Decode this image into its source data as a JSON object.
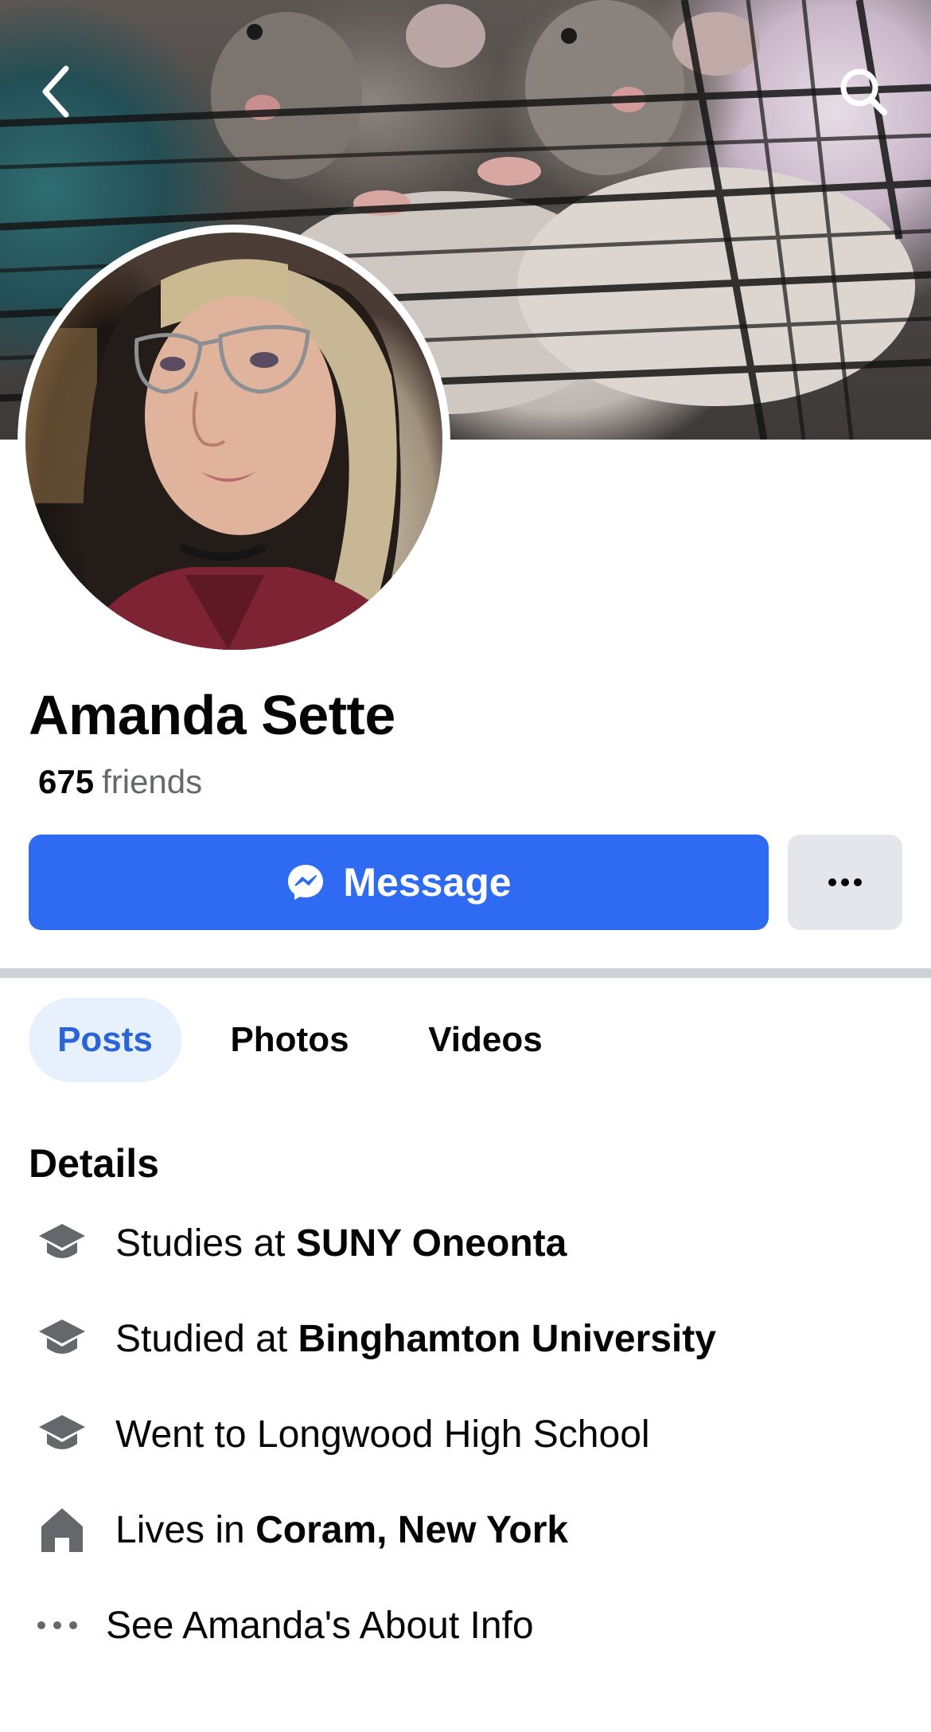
{
  "profile": {
    "name": "Amanda Sette",
    "friends_count": "675",
    "friends_label": "friends"
  },
  "actions": {
    "message_label": "Message",
    "more_label": "···"
  },
  "tabs": [
    {
      "label": "Posts",
      "active": true
    },
    {
      "label": "Photos",
      "active": false
    },
    {
      "label": "Videos",
      "active": false
    }
  ],
  "details": {
    "title": "Details",
    "items": [
      {
        "icon": "graduation-cap-icon",
        "prefix": "Studies at ",
        "value": "SUNY Oneonta"
      },
      {
        "icon": "graduation-cap-icon",
        "prefix": "Studied at ",
        "value": "Binghamton University"
      },
      {
        "icon": "graduation-cap-icon",
        "prefix": "Went to Longwood High School",
        "value": ""
      },
      {
        "icon": "home-icon",
        "prefix": "Lives in ",
        "value": "Coram, New York"
      }
    ],
    "about_link": "See Amanda's About Info"
  },
  "colors": {
    "primary": "#2f6bf2",
    "active_tab_bg": "#e7f0fd",
    "active_tab_text": "#2a64d6",
    "secondary_text": "#65676b",
    "icon_gray": "#65676b"
  },
  "icons": {
    "top_left": "chevron-left-icon",
    "top_right": "search-icon",
    "message": "messenger-icon",
    "more": "more-dots-icon"
  }
}
